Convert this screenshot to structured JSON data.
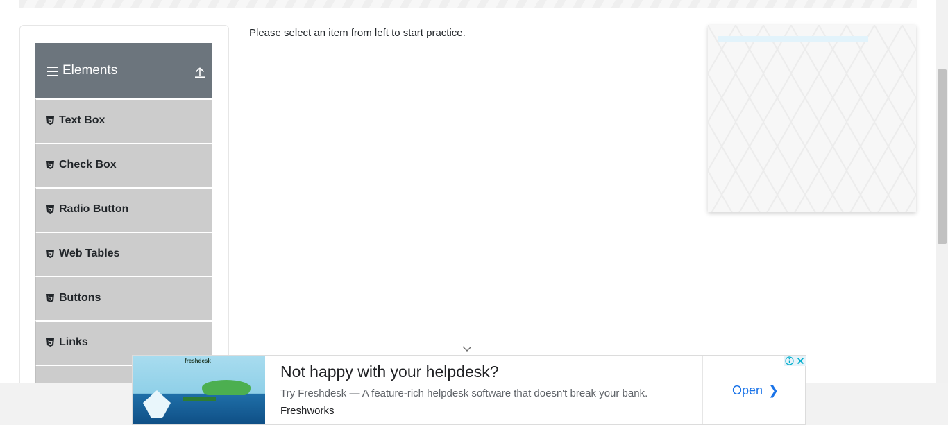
{
  "sidebar": {
    "group_title": "Elements",
    "items": [
      {
        "label": "Text Box"
      },
      {
        "label": "Check Box"
      },
      {
        "label": "Radio Button"
      },
      {
        "label": "Web Tables"
      },
      {
        "label": "Buttons"
      },
      {
        "label": "Links"
      }
    ]
  },
  "main": {
    "instruction": "Please select an item from left to start practice."
  },
  "ad": {
    "headline": "Not happy with your helpdesk?",
    "description": "Try Freshdesk — A feature-rich helpdesk software that doesn't break your bank.",
    "advertiser": "Freshworks",
    "open_label": "Open",
    "image_brand": "freshdesk"
  },
  "icons": {
    "menu": "hamburger-icon",
    "collapse": "upload-icon",
    "item": "html5-icon",
    "chevron": "chevron-down-icon",
    "ad_info": "info-icon",
    "ad_close": "close-icon"
  },
  "colors": {
    "group_header_bg": "#6c757d",
    "menu_item_bg": "#cccccc",
    "link_blue": "#1a73e8"
  }
}
